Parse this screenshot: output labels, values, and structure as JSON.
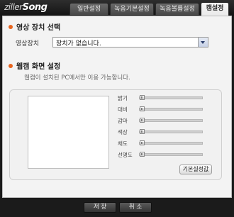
{
  "app": {
    "logo_prefix": "ziller",
    "logo_bold": "Song"
  },
  "tabs": [
    {
      "label": "일반설정"
    },
    {
      "label": "녹음기본설정"
    },
    {
      "label": "녹음볼륨설정"
    },
    {
      "label": "캠설정"
    }
  ],
  "video_section": {
    "title": "영상 장치 선택",
    "device_label": "영상장치",
    "device_value": "장치가 없습니다."
  },
  "webcam_section": {
    "title": "웹캠 화면 설정",
    "note": "웹캠이 설치된 PC에서만 이용 가능합니다.",
    "sliders": [
      {
        "label": "밝기",
        "value": 0
      },
      {
        "label": "대비",
        "value": 0
      },
      {
        "label": "감마",
        "value": 0
      },
      {
        "label": "색상",
        "value": 0
      },
      {
        "label": "채도",
        "value": 0
      },
      {
        "label": "선명도",
        "value": 0
      }
    ],
    "reset_label": "기본설정값"
  },
  "footer": {
    "save_label": "저 장",
    "cancel_label": "취 소"
  },
  "colors": {
    "accent": "#e8641e",
    "active_tab_bg": "#f3f3f3",
    "window_bg": "#1b1b1b"
  }
}
